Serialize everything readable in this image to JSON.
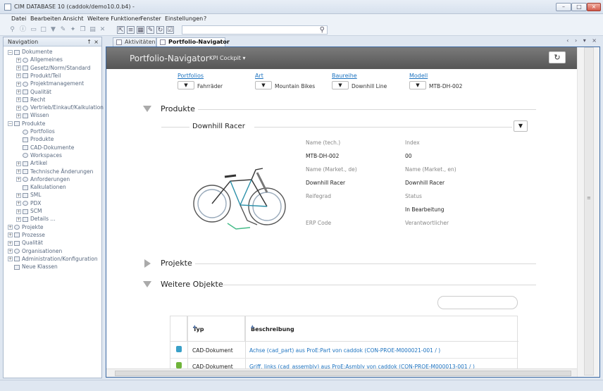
{
  "window": {
    "title": "CIM DATABASE 10 (caddok/demo10.0.b4) -",
    "minimize": "–",
    "maximize": "□",
    "close": "×"
  },
  "menu": [
    "Datei",
    "Bearbeiten",
    "Ansicht",
    "Weitere Funktionen",
    "Fenster",
    "Einstellungen",
    "?"
  ],
  "navigation": {
    "title": "Navigation",
    "pin": "↑",
    "close": "×",
    "tree": [
      {
        "label": "Dokumente",
        "level": 0,
        "exp": "−"
      },
      {
        "label": "Allgemeines",
        "level": 1,
        "exp": "+"
      },
      {
        "label": "Gesetz/Norm/Standard",
        "level": 1,
        "exp": "+"
      },
      {
        "label": "Produkt/Teil",
        "level": 1,
        "exp": "+"
      },
      {
        "label": "Projektmanagement",
        "level": 1,
        "exp": "+"
      },
      {
        "label": "Qualität",
        "level": 1,
        "exp": "+"
      },
      {
        "label": "Recht",
        "level": 1,
        "exp": "+"
      },
      {
        "label": "Vertrieb/Einkauf/Kalkulation",
        "level": 1,
        "exp": "+"
      },
      {
        "label": "Wissen",
        "level": 1,
        "exp": "+"
      },
      {
        "label": "Produkte",
        "level": 0,
        "exp": "−"
      },
      {
        "label": "Portfolios",
        "level": 1,
        "exp": ""
      },
      {
        "label": "Produkte",
        "level": 1,
        "exp": ""
      },
      {
        "label": "CAD-Dokumente",
        "level": 1,
        "exp": ""
      },
      {
        "label": "Workspaces",
        "level": 1,
        "exp": ""
      },
      {
        "label": "Artikel",
        "level": 1,
        "exp": "+"
      },
      {
        "label": "Technische Änderungen",
        "level": 1,
        "exp": "+"
      },
      {
        "label": "Anforderungen",
        "level": 1,
        "exp": "+"
      },
      {
        "label": "Kalkulationen",
        "level": 1,
        "exp": ""
      },
      {
        "label": "SML",
        "level": 1,
        "exp": "+"
      },
      {
        "label": "PDX",
        "level": 1,
        "exp": "+"
      },
      {
        "label": "SCM",
        "level": 1,
        "exp": "+"
      },
      {
        "label": "Details ...",
        "level": 1,
        "exp": "+"
      },
      {
        "label": "Projekte",
        "level": 0,
        "exp": "+"
      },
      {
        "label": "Prozesse",
        "level": 0,
        "exp": "+"
      },
      {
        "label": "Qualität",
        "level": 0,
        "exp": "+"
      },
      {
        "label": "Organisationen",
        "level": 0,
        "exp": "+"
      },
      {
        "label": "Administration/Konfiguration",
        "level": 0,
        "exp": "+"
      },
      {
        "label": "Neue Klassen",
        "level": 0,
        "exp": ""
      }
    ]
  },
  "tabs": [
    {
      "label": "Aktivitäten",
      "active": false
    },
    {
      "label": "Portfolio-Navigator",
      "active": true,
      "close": "×"
    }
  ],
  "tab_nav": "‹ › ▾ ×",
  "portal": {
    "title": "Portfolio-Navigator",
    "kpi": "KPI Cockpit ▾",
    "refresh": "↻"
  },
  "filters": [
    {
      "label": "Portfolios",
      "value": "Fahrräder"
    },
    {
      "label": "Art",
      "value": "Mountain Bikes"
    },
    {
      "label": "Baureihe",
      "value": "Downhill Line"
    },
    {
      "label": "Modell",
      "value": "MTB-DH-002"
    }
  ],
  "dropdown_glyph": "▼",
  "products": {
    "heading": "Produkte",
    "item_name": "Downhill Racer",
    "props": [
      {
        "label": "Name (tech.)",
        "value": "MTB-DH-002"
      },
      {
        "label": "Index",
        "value": "00"
      },
      {
        "label": "Name (Market., de)",
        "value": "Downhill Racer"
      },
      {
        "label": "Name (Market., en)",
        "value": "Downhill Racer"
      },
      {
        "label": "Reifegrad",
        "value": ""
      },
      {
        "label": "Status",
        "value": "In Bearbeitung"
      },
      {
        "label": "ERP Code",
        "value": ""
      },
      {
        "label": "Verantwortlicher",
        "value": ""
      }
    ]
  },
  "projects": {
    "heading": "Projekte"
  },
  "more_objects": {
    "heading": "Weitere Objekte",
    "columns": [
      "Typ",
      "Beschreibung"
    ],
    "sort_glyph": "▲",
    "rows": [
      {
        "type": "CAD-Dokument",
        "description": "Achse (cad_part) aus ProE:Part von caddok (CON-PROE-M000021-001 / )",
        "icon_color": "#3aa0c8"
      },
      {
        "type": "CAD-Dokument",
        "description": "Griff, links (cad_assembly) aus ProE:Asmbly von caddok (CON-PROE-M000013-001 / )",
        "icon_color": "#6fb43a"
      }
    ]
  }
}
